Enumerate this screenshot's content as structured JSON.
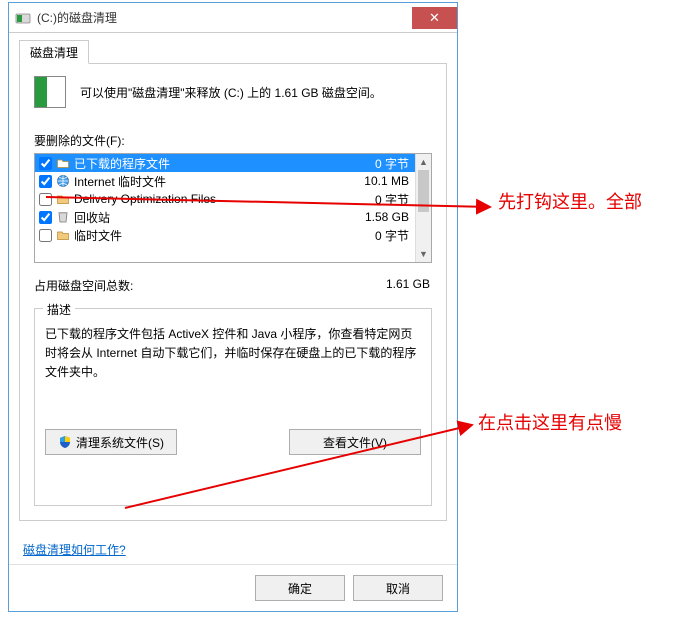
{
  "titlebar": {
    "title": "(C:)的磁盘清理",
    "close_glyph": "✕"
  },
  "tab": {
    "label": "磁盘清理"
  },
  "intro": {
    "text": "可以使用\"磁盘清理\"来释放 (C:) 上的 1.61 GB 磁盘空间。"
  },
  "files_label": "要删除的文件(F):",
  "files": [
    {
      "checked": true,
      "icon": "folder",
      "name": "已下载的程序文件",
      "size": "0 字节",
      "selected": true
    },
    {
      "checked": true,
      "icon": "inet",
      "name": "Internet 临时文件",
      "size": "10.1 MB",
      "selected": false
    },
    {
      "checked": false,
      "icon": "folder",
      "name": "Delivery Optimization Files",
      "size": "0 字节",
      "selected": false
    },
    {
      "checked": true,
      "icon": "bin",
      "name": "回收站",
      "size": "1.58 GB",
      "selected": false
    },
    {
      "checked": false,
      "icon": "folder",
      "name": "临时文件",
      "size": "0 字节",
      "selected": false
    }
  ],
  "total": {
    "label": "占用磁盘空间总数:",
    "value": "1.61 GB"
  },
  "description": {
    "legend": "描述",
    "text": "已下载的程序文件包括 ActiveX 控件和 Java 小程序，你查看特定网页时将会从 Internet 自动下载它们，并临时保存在硬盘上的已下载的程序文件夹中。"
  },
  "buttons": {
    "clean_system": "清理系统文件(S)",
    "view_files": "查看文件(V)",
    "ok": "确定",
    "cancel": "取消"
  },
  "link": {
    "text": "磁盘清理如何工作?"
  },
  "annotations": {
    "a1": "先打钩这里。全部",
    "a2": "在点击这里有点慢"
  }
}
